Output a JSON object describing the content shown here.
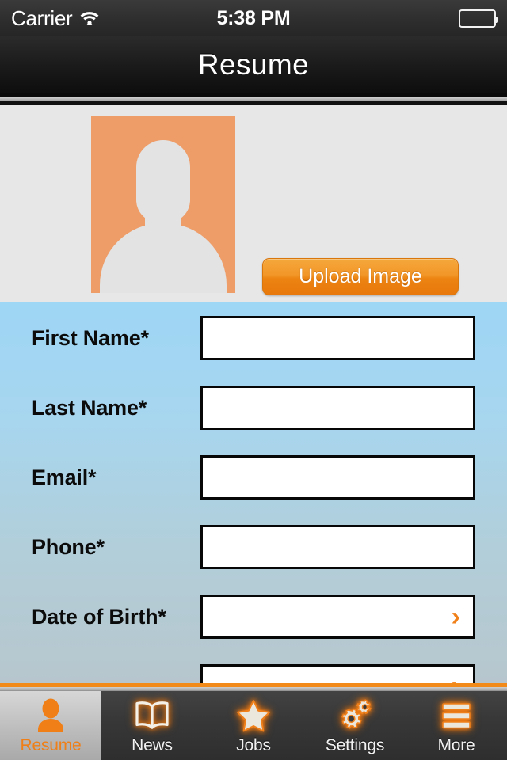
{
  "status_bar": {
    "carrier": "Carrier",
    "wifi_icon": "wifi-icon",
    "time": "5:38 PM",
    "battery_icon": "battery-full-icon"
  },
  "nav_bar": {
    "title": "Resume"
  },
  "photo_section": {
    "avatar_placeholder_icon": "person-placeholder-icon",
    "upload_button_label": "Upload Image"
  },
  "form": {
    "fields": [
      {
        "label": "First Name*",
        "value": "",
        "placeholder": "",
        "has_chevron": false
      },
      {
        "label": "Last Name*",
        "value": "",
        "placeholder": "",
        "has_chevron": false
      },
      {
        "label": "Email*",
        "value": "",
        "placeholder": "",
        "has_chevron": false
      },
      {
        "label": "Phone*",
        "value": "",
        "placeholder": "",
        "has_chevron": false
      },
      {
        "label": "Date of Birth*",
        "value": "",
        "placeholder": "",
        "has_chevron": true
      },
      {
        "label": "",
        "value": "",
        "placeholder": "",
        "has_chevron": true
      }
    ],
    "chevron_glyph": "›"
  },
  "tab_bar": {
    "items": [
      {
        "label": "Resume",
        "icon": "person-icon",
        "active": true
      },
      {
        "label": "News",
        "icon": "book-icon",
        "active": false
      },
      {
        "label": "Jobs",
        "icon": "star-icon",
        "active": false
      },
      {
        "label": "Settings",
        "icon": "gears-icon",
        "active": false
      },
      {
        "label": "More",
        "icon": "hamburger-icon",
        "active": false
      }
    ]
  },
  "colors": {
    "accent_orange": "#f0801a",
    "avatar_orange": "#ee9c68",
    "form_blue": "#9ed6f5",
    "panel_gray": "#e7e7e7",
    "bar_dark": "#2e2e2e"
  }
}
